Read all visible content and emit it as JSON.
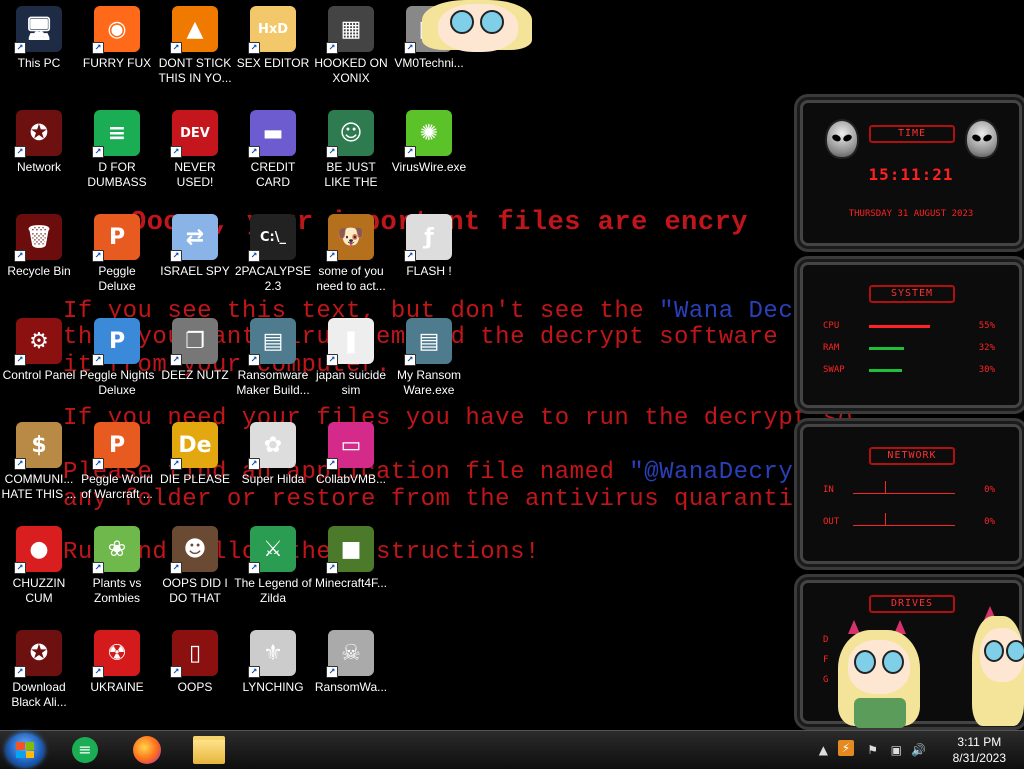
{
  "wallpaper": {
    "title": "Ooops, your important files are encry",
    "line1a": "If you see this text, but don't see the ",
    "line1b": "\"Wana Decryp",
    "line2": "then your antivirus removed the decrypt software or",
    "line3": "it from your computer.",
    "line4": "If you need your files you have to run the decrypt so",
    "line5a": "Please find an application file named ",
    "line5b": "\"@WanaDecrypto",
    "line6": "any folder or restore from the antivirus quarantine.",
    "line7": "Run and follow the instructions!"
  },
  "icons": [
    {
      "label": "This PC",
      "icon": "monitor-icon",
      "glyph": "🖥",
      "color": "#1d2b44"
    },
    {
      "label": "FURRY FUX",
      "icon": "firefox-icon",
      "glyph": "◉",
      "color": "#ff6a1a"
    },
    {
      "label": "DONT STICK THIS IN YO...",
      "icon": "vlc-cone-icon",
      "glyph": "▲",
      "color": "#f07a00"
    },
    {
      "label": "SEX EDITOR",
      "icon": "hxd-icon",
      "glyph": "HxD",
      "color": "#f2c86b"
    },
    {
      "label": "HOOKED ON XONIX",
      "icon": "xonix-icon",
      "glyph": "▦",
      "color": "#444"
    },
    {
      "label": "VM0Techni...",
      "icon": "vm-icon",
      "glyph": "▣",
      "color": "#888"
    },
    {
      "label": "Network",
      "icon": "alien-network-icon",
      "glyph": "✪",
      "color": "#6d1010"
    },
    {
      "label": "D FOR DUMBASS",
      "icon": "doc-green-icon",
      "glyph": "≡",
      "color": "#1aad54"
    },
    {
      "label": "NEVER USED!",
      "icon": "devcpp-icon",
      "glyph": "DEV",
      "color": "#c4161c"
    },
    {
      "label": "CREDIT CARD CHECKER",
      "icon": "credit-card-icon",
      "glyph": "▬",
      "color": "#6d5bd0"
    },
    {
      "label": "BE JUST LIKE THE DUDE!",
      "icon": "santa-icon",
      "glyph": "☺",
      "color": "#2d7b4f"
    },
    {
      "label": "VirusWire.exe",
      "icon": "limewire-icon",
      "glyph": "✺",
      "color": "#5cc22a"
    },
    {
      "label": "Recycle Bin",
      "icon": "recycle-bin-icon",
      "glyph": "🗑",
      "color": "#6b0d0d"
    },
    {
      "label": "Peggle Deluxe",
      "icon": "peggle-icon",
      "glyph": "P",
      "color": "#e85b20"
    },
    {
      "label": "ISRAEL SPY",
      "icon": "remote-pc-icon",
      "glyph": "⇄",
      "color": "#8ab4e8"
    },
    {
      "label": "2PACALYPSE 2.3",
      "icon": "terminal-icon",
      "glyph": "C:\\_",
      "color": "#222"
    },
    {
      "label": "some of you need to act...",
      "icon": "scooby-icon",
      "glyph": "🐶",
      "color": "#b5701e"
    },
    {
      "label": "FLASH !",
      "icon": "flash-doc-icon",
      "glyph": "ƒ",
      "color": "#ddd"
    },
    {
      "label": "Control Panel",
      "icon": "control-panel-icon",
      "glyph": "⚙",
      "color": "#8b1010"
    },
    {
      "label": "Peggle Nights Deluxe",
      "icon": "peggle-nights-icon",
      "glyph": "P",
      "color": "#3b8ad9"
    },
    {
      "label": "DEEZ NUTZ",
      "icon": "windows-stack-icon",
      "glyph": "❐",
      "color": "#777"
    },
    {
      "label": "Ransomware Maker Build...",
      "icon": "app-window-icon",
      "glyph": "▤",
      "color": "#4e7b8e"
    },
    {
      "label": "japan suicide sim",
      "icon": "file-doc-icon",
      "glyph": "❚",
      "color": "#eee"
    },
    {
      "label": "My Ransom Ware.exe",
      "icon": "app-window-icon",
      "glyph": "▤",
      "color": "#4e7b8e"
    },
    {
      "label": "COMMUNI... HATE THIS ...",
      "icon": "money-bag-icon",
      "glyph": "$",
      "color": "#b88a45"
    },
    {
      "label": "Peggle World of Warcraft ...",
      "icon": "peggle-wow-icon",
      "glyph": "P",
      "color": "#e85b20"
    },
    {
      "label": "DIE PLEASE",
      "icon": "de-icon",
      "glyph": "De",
      "color": "#e3a80f"
    },
    {
      "label": "Super Hilda",
      "icon": "hilda-icon",
      "glyph": "✿",
      "color": "#ddd"
    },
    {
      "label": "CollabVMB...",
      "icon": "monitor-pink-icon",
      "glyph": "▭",
      "color": "#d42a8a"
    },
    {
      "label": "CHUZZIN CUM",
      "icon": "chuzzle-icon",
      "glyph": "●",
      "color": "#d81e1e"
    },
    {
      "label": "Plants vs Zombies",
      "icon": "pvz-flower-icon",
      "glyph": "❀",
      "color": "#6fb84c"
    },
    {
      "label": "OOPS DID I DO THAT",
      "icon": "portrait-icon",
      "glyph": "☻",
      "color": "#6b4a33"
    },
    {
      "label": "The Legend of Zilda",
      "icon": "zelda-icon",
      "glyph": "⚔",
      "color": "#2a9d52"
    },
    {
      "label": "Minecraft4F...",
      "icon": "grass-block-icon",
      "glyph": "■",
      "color": "#4a7a2a"
    },
    {
      "label": "Download Black Ali...",
      "icon": "alien-download-icon",
      "glyph": "✪",
      "color": "#6d1010"
    },
    {
      "label": "UKRAINE",
      "icon": "radiation-icon",
      "glyph": "☢",
      "color": "#d41a1a"
    },
    {
      "label": "OOPS",
      "icon": "alien-book-icon",
      "glyph": "▯",
      "color": "#8b1010"
    },
    {
      "label": "LYNCHING",
      "icon": "knot-icon",
      "glyph": "⚜",
      "color": "#ccc"
    },
    {
      "label": "RansomWa...",
      "icon": "skull-icon",
      "glyph": "☠",
      "color": "#aaa"
    }
  ],
  "gadget": {
    "time": {
      "header": "TIME",
      "clock": "15:11:21",
      "date": "THURSDAY 31 AUGUST 2023"
    },
    "system": {
      "header": "SYSTEM",
      "rows": [
        {
          "label": "CPU",
          "value": "55%",
          "bar": 0.55
        },
        {
          "label": "RAM",
          "value": "32%",
          "bar": 0.32
        },
        {
          "label": "SWAP",
          "value": "30%",
          "bar": 0.3
        }
      ]
    },
    "network": {
      "header": "NETWORK",
      "rows": [
        {
          "label": "IN",
          "value": "0%"
        },
        {
          "label": "OUT",
          "value": "0%"
        }
      ]
    },
    "drives": {
      "header": "DRIVES",
      "rows": [
        {
          "label": "D"
        },
        {
          "label": "F"
        },
        {
          "label": "G"
        }
      ]
    }
  },
  "taskbar": {
    "items": [
      {
        "icon": "doc-green-icon"
      },
      {
        "icon": "firefox-icon"
      },
      {
        "icon": "folder-icon"
      }
    ],
    "clock_time": "3:11 PM",
    "clock_date": "8/31/2023"
  },
  "colors": {
    "wall_red": "#c0161a",
    "wall_blue": "#2a3fb8",
    "gadget_red": "#ff2222"
  }
}
